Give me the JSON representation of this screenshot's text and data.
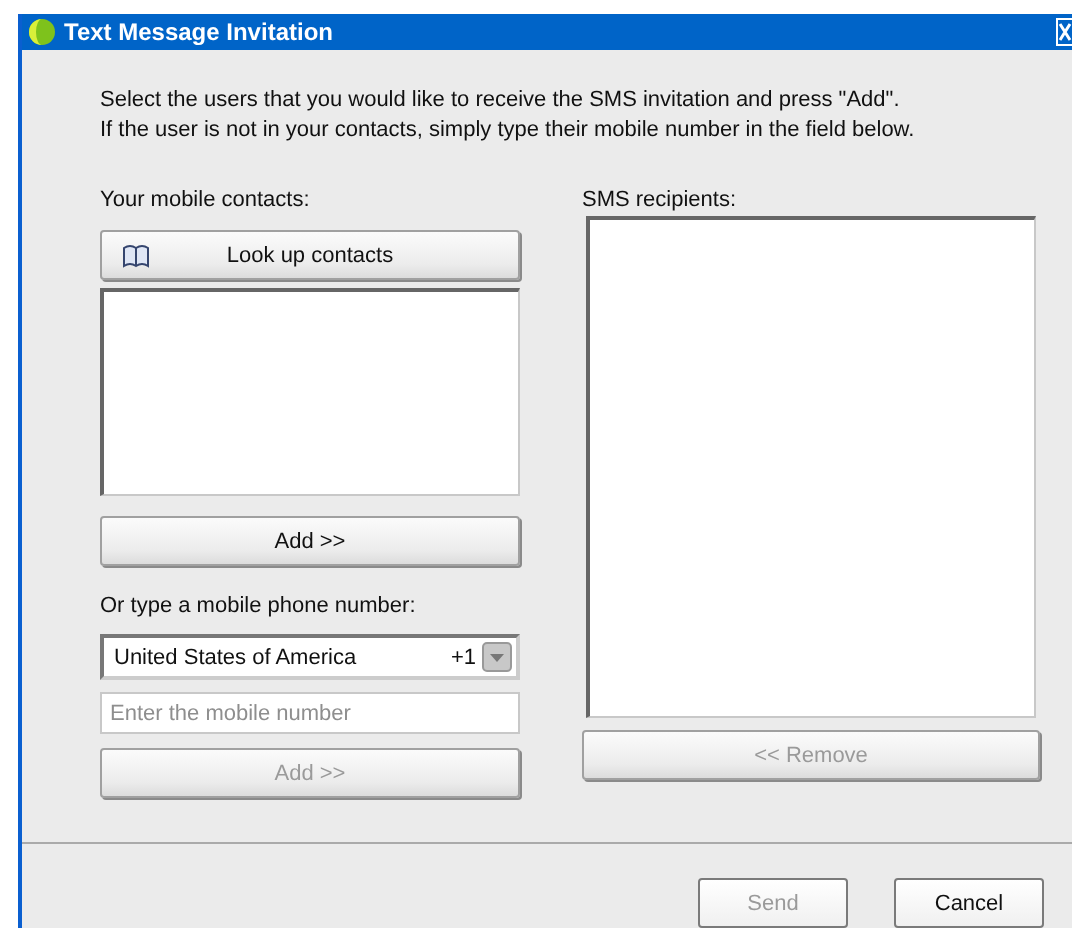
{
  "window": {
    "title": "Text Message Invitation"
  },
  "instructions": [
    "Select the users that you would like to receive the SMS invitation and press \"Add\".",
    "If the user is not in your contacts, simply type their mobile number in the field below."
  ],
  "contacts": {
    "label": "Your mobile contacts:",
    "lookup_button": {
      "label": "Look up contacts",
      "disabled": false
    },
    "add_button": {
      "label": "Add >>",
      "disabled": false
    }
  },
  "manual_entry": {
    "label": "Or type a mobile phone number:",
    "country": {
      "value": "United States of America",
      "code": "+1"
    },
    "number_field": {
      "placeholder": "Enter the mobile number"
    },
    "add_button": {
      "label": "Add >>",
      "disabled": true
    }
  },
  "recipients": {
    "label": "SMS recipients:",
    "remove_button": {
      "label": "<< Remove",
      "disabled": true
    }
  },
  "footer_buttons": [
    {
      "label": "Send",
      "disabled": true
    },
    {
      "label": "Cancel",
      "disabled": false
    }
  ]
}
